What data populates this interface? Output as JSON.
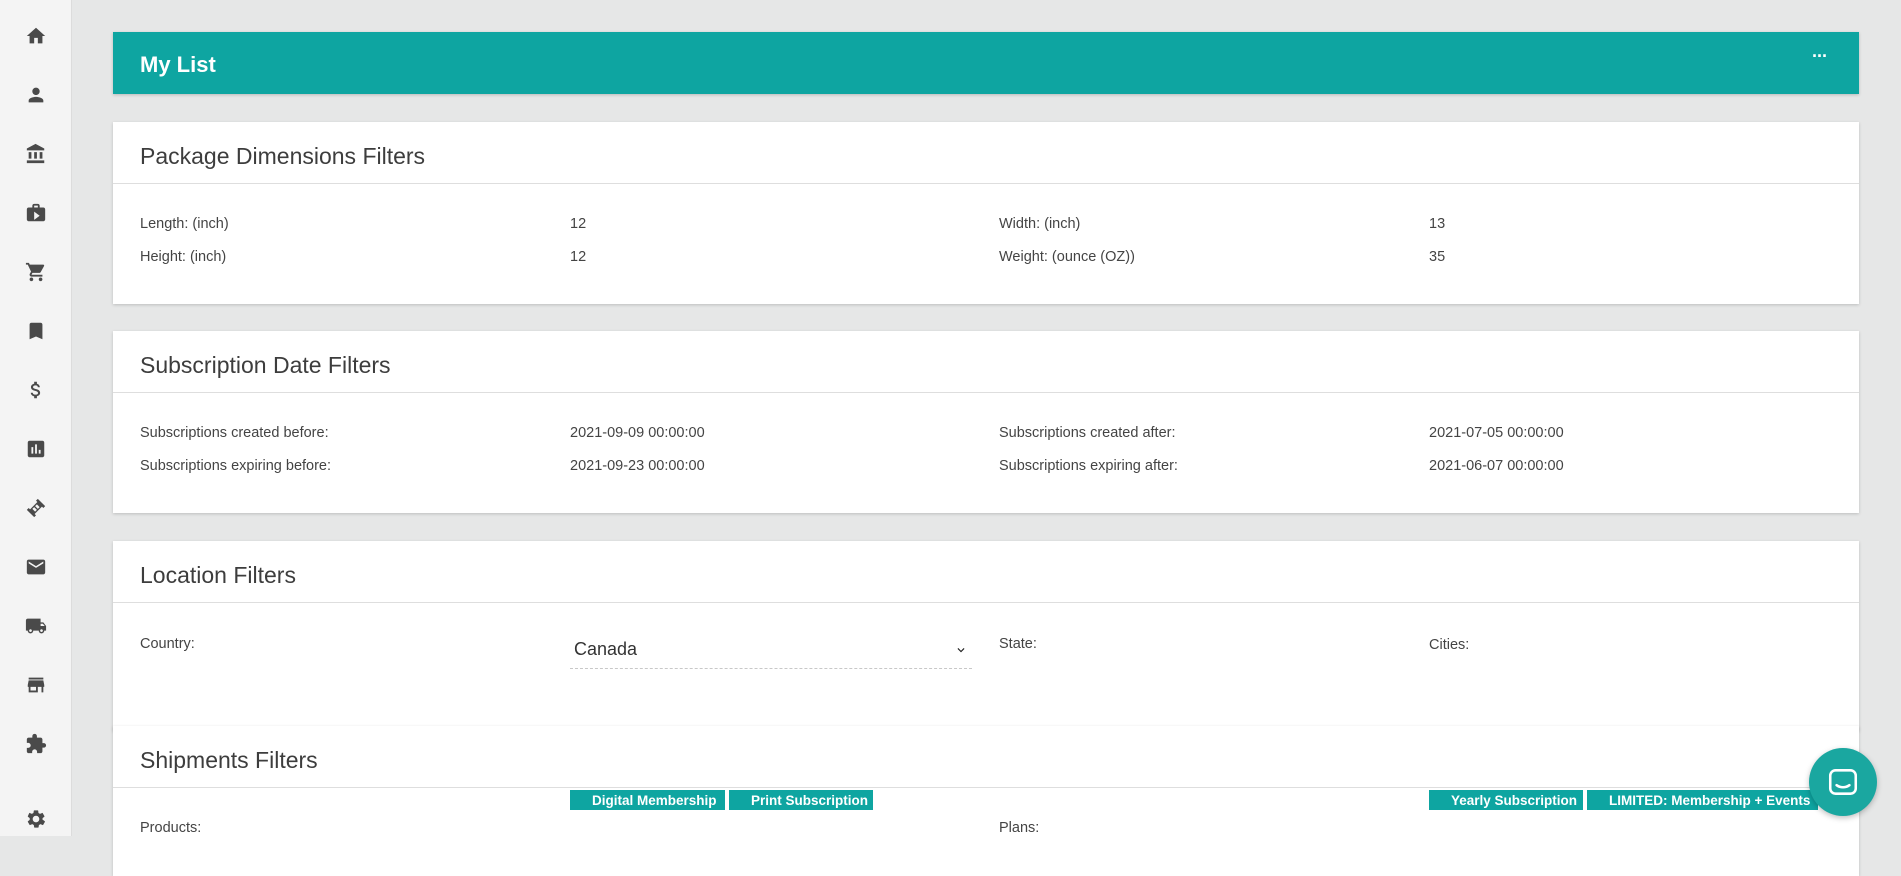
{
  "sidebar": {
    "icons": [
      {
        "name": "home-icon"
      },
      {
        "name": "person-icon"
      },
      {
        "name": "bank-icon"
      },
      {
        "name": "briefcase-play-icon"
      },
      {
        "name": "cart-icon"
      },
      {
        "name": "bookmark-icon"
      },
      {
        "name": "dollar-icon"
      },
      {
        "name": "chart-icon"
      },
      {
        "name": "ticket-icon"
      },
      {
        "name": "mail-icon"
      },
      {
        "name": "truck-icon"
      },
      {
        "name": "store-icon"
      },
      {
        "name": "puzzle-icon"
      },
      {
        "name": "gear-icon"
      }
    ]
  },
  "header": {
    "title": "My List",
    "more_label": "···"
  },
  "package": {
    "title": "Package Dimensions Filters",
    "length_label": "Length: (inch)",
    "length_value": "12",
    "width_label": "Width: (inch)",
    "width_value": "13",
    "height_label": "Height: (inch)",
    "height_value": "12",
    "weight_label": "Weight: (ounce (OZ))",
    "weight_value": "35"
  },
  "subscription": {
    "title": "Subscription Date Filters",
    "created_before_label": "Subscriptions created before:",
    "created_before_value": "2021-09-09 00:00:00",
    "created_after_label": "Subscriptions created after:",
    "created_after_value": "2021-07-05 00:00:00",
    "expiring_before_label": "Subscriptions expiring before:",
    "expiring_before_value": "2021-09-23 00:00:00",
    "expiring_after_label": "Subscriptions expiring after:",
    "expiring_after_value": "2021-06-07 00:00:00"
  },
  "location": {
    "title": "Location Filters",
    "country_label": "Country:",
    "country_value": "Canada",
    "state_label": "State:",
    "cities_label": "Cities:"
  },
  "shipments": {
    "title": "Shipments Filters",
    "products_label": "Products:",
    "products": [
      "Digital Membership",
      "Print Subscription"
    ],
    "plans_label": "Plans:",
    "plans": [
      "Yearly Subscription",
      "LIMITED: Membership + Events"
    ]
  },
  "colors": {
    "accent": "#0ea5a1",
    "chat": "#1aa7a0"
  }
}
